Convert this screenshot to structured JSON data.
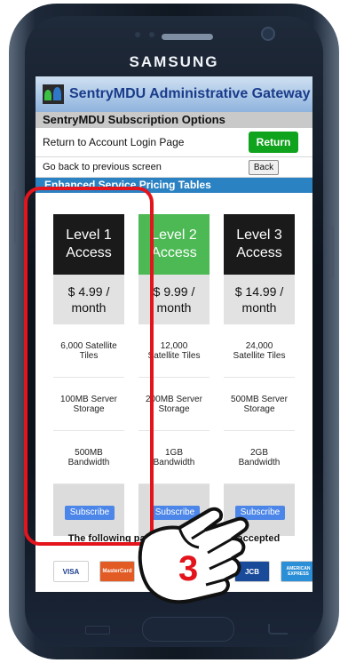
{
  "device": {
    "brand": "SAMSUNG"
  },
  "app": {
    "title": "SentryMDU Administrative Gateway",
    "section_title": "SentryMDU Subscription Options",
    "return_row": {
      "label": "Return to Account Login Page",
      "button": "Return"
    },
    "back_row": {
      "label": "Go back to previous screen",
      "button": "Back"
    },
    "pricing_band": "Enhanced Service Pricing Tables"
  },
  "plans": [
    {
      "name": "Level 1 Access",
      "line1": "Level 1",
      "line2": "Access",
      "price": "$ 4.99 /",
      "period": "month",
      "tiles": "6,000 Satellite Tiles",
      "storage": "100MB Server Storage",
      "bandwidth": "500MB Bandwidth",
      "subscribe": "Subscribe",
      "color": "#1a1a1a"
    },
    {
      "name": "Level 2 Access",
      "line1": "Level 2",
      "line2": "Access",
      "price": "$ 9.99 /",
      "period": "month",
      "tiles": "12,000 Satellite Tiles",
      "storage": "200MB Server Storage",
      "bandwidth": "1GB Bandwidth",
      "subscribe": "Subscribe",
      "color": "#4cb954"
    },
    {
      "name": "Level 3 Access",
      "line1": "Level 3",
      "line2": "Access",
      "price": "$ 14.99 /",
      "period": "month",
      "tiles": "24,000 Satellite Tiles",
      "storage": "500MB Server Storage",
      "bandwidth": "2GB Bandwidth",
      "subscribe": "Subscribe",
      "color": "#1a1a1a"
    }
  ],
  "payments": {
    "title": "The following payment methods are accepted",
    "methods": [
      "VISA",
      "MasterCard",
      "",
      "JCB",
      "AMERICAN EXPRESS"
    ]
  },
  "annotation": {
    "step_number": "3",
    "highlight_color": "#e3141c"
  }
}
